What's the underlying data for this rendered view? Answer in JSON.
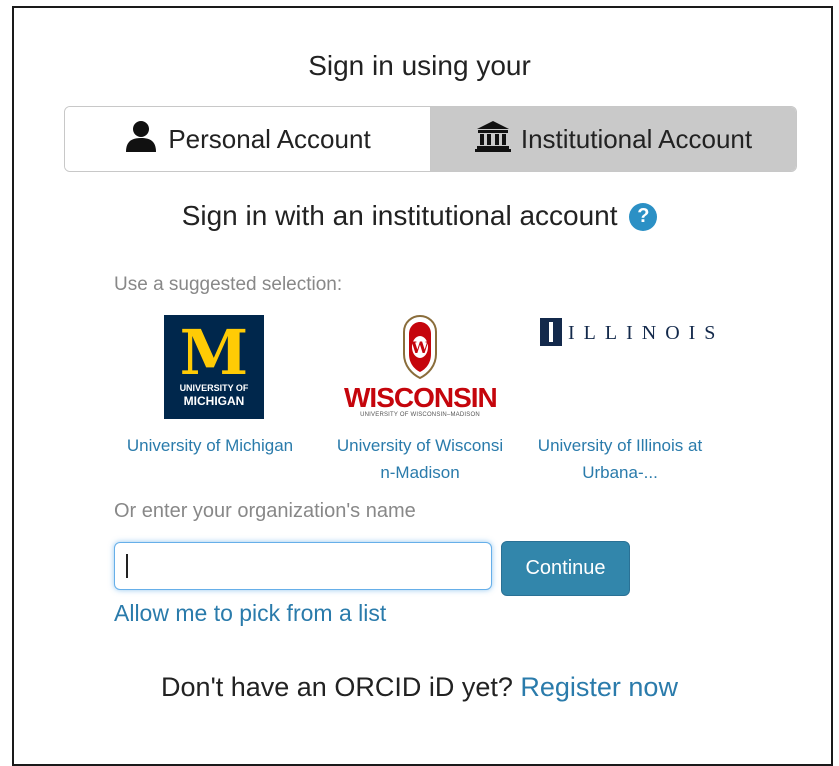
{
  "header": {
    "title": "Sign in using your"
  },
  "account_toggle": {
    "personal_label": "Personal Account",
    "institutional_label": "Institutional Account",
    "selected": "institutional"
  },
  "institutional": {
    "heading": "Sign in with an institutional account",
    "help_icon_glyph": "?",
    "suggest_label": "Use a suggested selection:",
    "suggestions": [
      {
        "name": "University of Michigan",
        "logo": {
          "mark": "M",
          "line1": "UNIVERSITY OF",
          "line2": "MICHIGAN",
          "background": "#00274c",
          "accent": "#ffcb05"
        }
      },
      {
        "name_line1": "University of Wisconsi",
        "name_line2": "n-Madison",
        "logo": {
          "crest_letter": "W",
          "wordmark": "WISCONSIN",
          "subtext": "UNIVERSITY OF WISCONSIN–MADISON",
          "color": "#c5050c"
        }
      },
      {
        "name_line1": "University of Illinois at",
        "name_line2": "Urbana-...",
        "logo": {
          "wordmark": "ILLINOIS",
          "color": "#13294b"
        }
      }
    ],
    "org_label": "Or enter your organization's name",
    "org_input_value": "",
    "continue_label": "Continue",
    "pick_list_link": "Allow me to pick from a list"
  },
  "footer": {
    "prompt": "Don't have an ORCID iD yet?",
    "register_link": "Register now"
  },
  "colors": {
    "link": "#2a7bab",
    "primary_button": "#3286ab",
    "help_icon": "#2b90c5",
    "toggle_selected_bg": "#c9c9c9"
  },
  "icons": {
    "personal": "person-icon",
    "institutional": "institution-icon",
    "help": "question-circle-icon"
  }
}
